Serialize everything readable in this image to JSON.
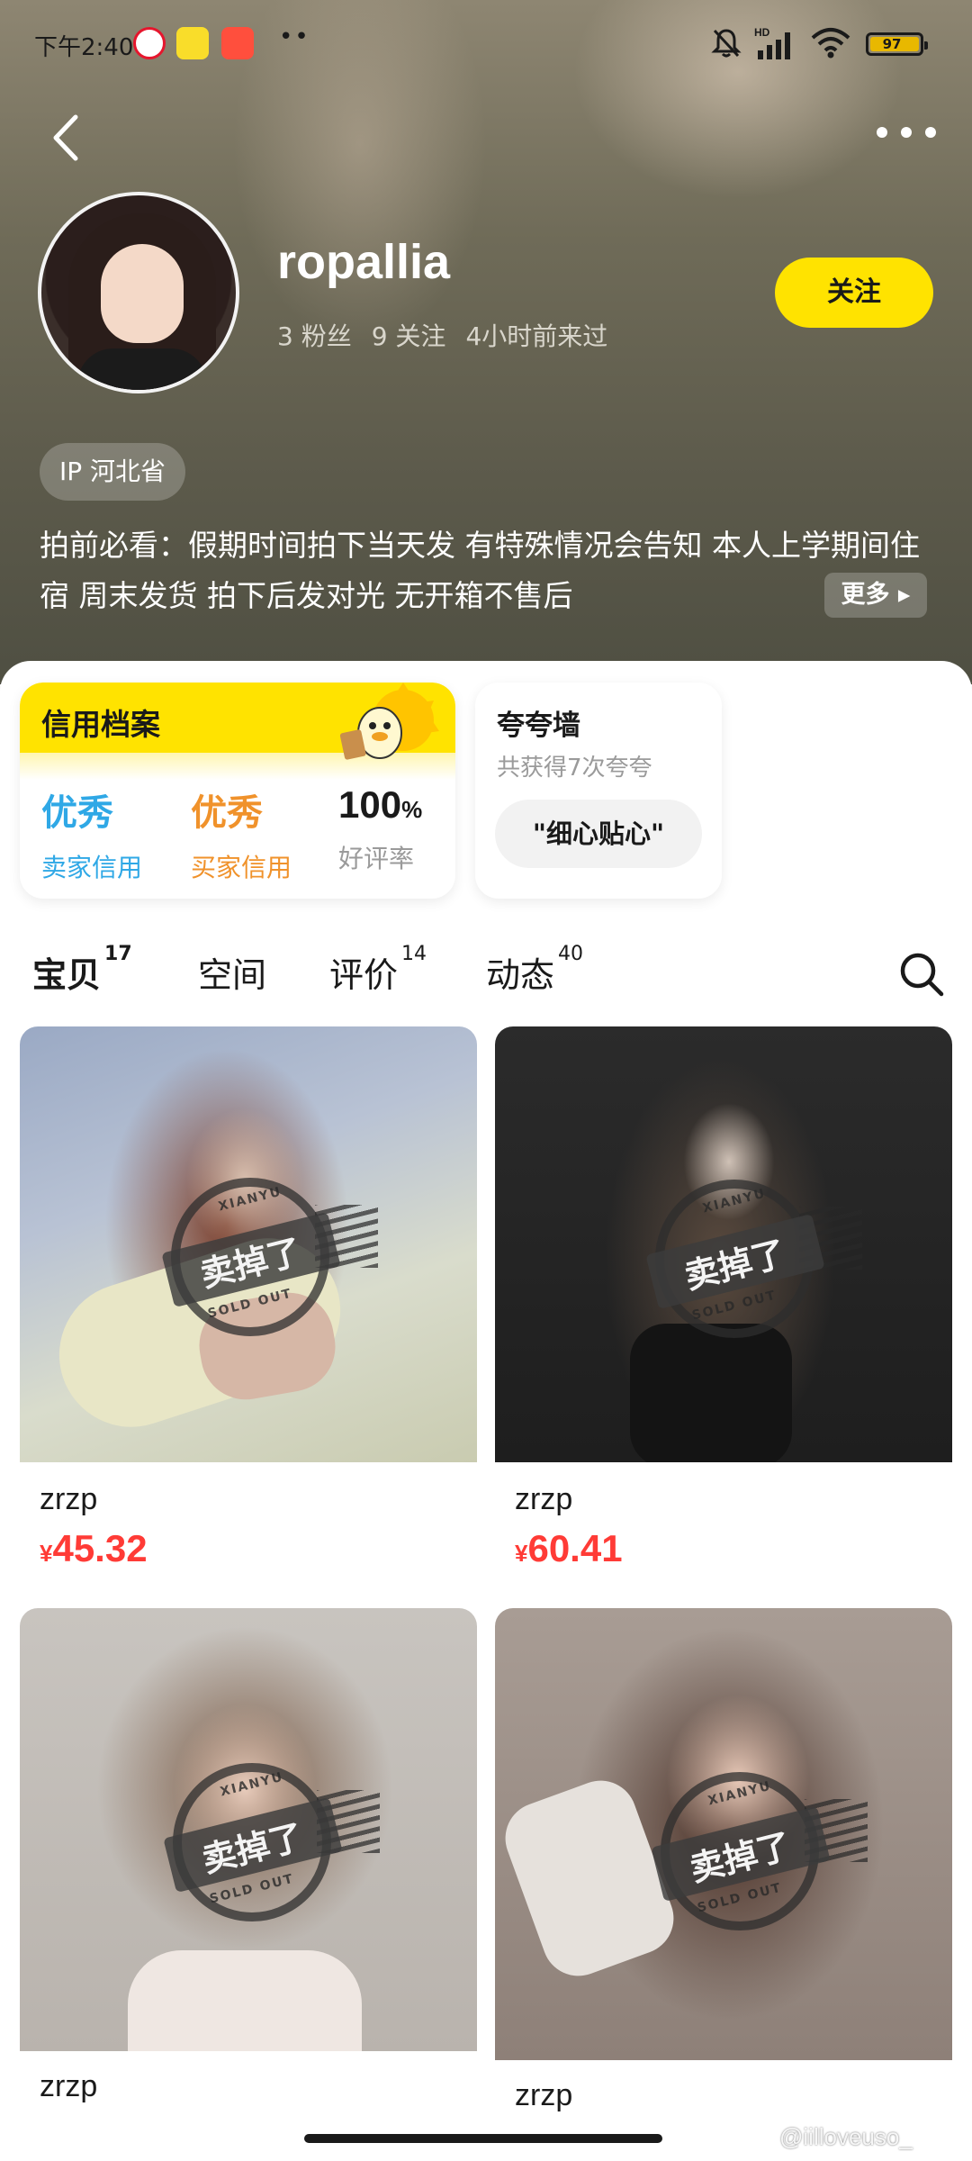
{
  "status_bar": {
    "time": "下午2:40",
    "overflow": "••",
    "battery": "97"
  },
  "profile": {
    "username": "ropallia",
    "fans": "3 粉丝",
    "following": "9 关注",
    "last_seen": "4小时前来过",
    "follow_label": "关注",
    "ip": "IP 河北省",
    "bio": "拍前必看：假期时间拍下当天发 有特殊情况会告知 本人上学期间住宿 周末发货 拍下后发对光 无开箱不售后",
    "more_label": "更多"
  },
  "credit": {
    "title": "信用档案",
    "seller": {
      "value": "优秀",
      "label": "卖家信用"
    },
    "buyer": {
      "value": "优秀",
      "label": "买家信用"
    },
    "rating": {
      "value": "100",
      "unit": "%",
      "label": "好评率"
    }
  },
  "praise": {
    "title": "夸夸墙",
    "subtitle": "共获得7次夸夸",
    "tag": "\"细心贴心\""
  },
  "tabs": [
    {
      "label": "宝贝",
      "count": "17"
    },
    {
      "label": "空间",
      "count": ""
    },
    {
      "label": "评价",
      "count": "14"
    },
    {
      "label": "动态",
      "count": "40"
    }
  ],
  "products": [
    {
      "name": "zrzp",
      "currency": "¥",
      "price": "45.32",
      "sold_label": "卖掉了",
      "stamp_top": "XIANYU",
      "stamp_bottom": "SOLD OUT"
    },
    {
      "name": "zrzp",
      "currency": "¥",
      "price": "60.41",
      "sold_label": "卖掉了",
      "stamp_top": "XIANYU",
      "stamp_bottom": "SOLD OUT"
    },
    {
      "name": "zrzp",
      "sold_label": "卖掉了",
      "stamp_top": "XIANYU",
      "stamp_bottom": "SOLD OUT"
    },
    {
      "name": "zrzp",
      "sold_label": "卖掉了",
      "stamp_top": "XIANYU",
      "stamp_bottom": "SOLD OUT"
    }
  ],
  "watermark": "@iilloveuso_",
  "colors": {
    "accent": "#ffe300",
    "price": "#ff3b36",
    "seller_credit": "#2fa8e6",
    "buyer_credit": "#f0922b"
  }
}
